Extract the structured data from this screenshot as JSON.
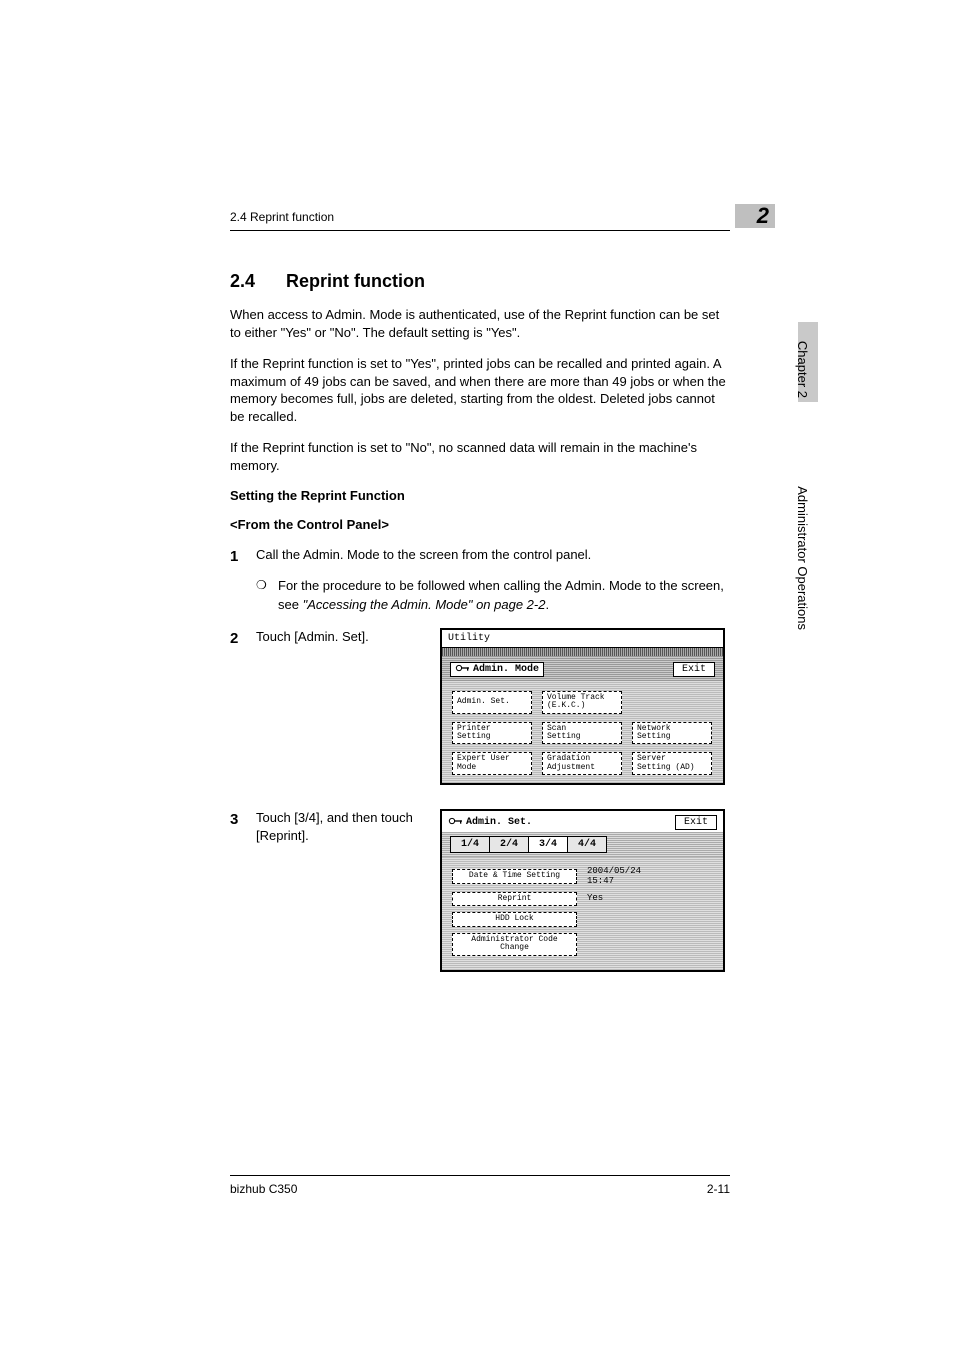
{
  "header": {
    "running_head": "2.4 Reprint function",
    "chapter_badge": "2"
  },
  "section": {
    "number": "2.4",
    "title": "Reprint function",
    "para1": "When access to Admin. Mode is authenticated, use of the Reprint function can be set to either \"Yes\" or \"No\". The default setting is \"Yes\".",
    "para2": "If the Reprint function is set to \"Yes\", printed jobs can be recalled and printed again. A maximum of 49 jobs can be saved, and when there are more than 49 jobs or when the memory becomes full, jobs are deleted, starting from the oldest. Deleted jobs cannot be recalled.",
    "para3": "If the Reprint function is set to \"No\", no scanned data will remain in the machine's memory.",
    "sub1": "Setting the Reprint Function",
    "sub2": "<From the Control Panel>"
  },
  "steps": {
    "s1_n": "1",
    "s1_t": "Call the Admin. Mode to the screen from the control panel.",
    "s1_b_marker": "❍",
    "s1_b_t_a": "For the procedure to be followed when calling the Admin. Mode to the screen, see ",
    "s1_b_t_ref": "\"Accessing the Admin. Mode\" on page 2-2",
    "s1_b_t_c": ".",
    "s2_n": "2",
    "s2_t": "Touch [Admin. Set].",
    "s3_n": "3",
    "s3_t": "Touch [3/4], and then touch [Reprint]."
  },
  "figure1": {
    "utility": "Utility",
    "mode_title": "Admin. Mode",
    "exit": "Exit",
    "row1": {
      "a": "Admin. Set.",
      "b": "Volume Track\n(E.K.C.)"
    },
    "row2": {
      "a": "Printer\nSetting",
      "b": "Scan\nSetting",
      "c": "Network\nSetting"
    },
    "row3": {
      "a": "Expert User\nMode",
      "b": "Gradation\nAdjustment",
      "c": "Server\nSetting (AD)"
    }
  },
  "figure2": {
    "title": "Admin. Set.",
    "exit": "Exit",
    "tabs": {
      "t1": "1/4",
      "t2": "2/4",
      "t3": "3/4",
      "t4": "4/4"
    },
    "rows": {
      "r1_label": "Date & Time Setting",
      "r1_value": "2004/05/24\n15:47",
      "r2_label": "Reprint",
      "r2_value": "Yes",
      "r3_label": "HDD Lock",
      "r4_label": "Administrator Code\nChange"
    }
  },
  "side": {
    "vertical": "Administrator Operations",
    "chapter": "Chapter 2"
  },
  "footer": {
    "left": "bizhub C350",
    "right": "2-11"
  }
}
